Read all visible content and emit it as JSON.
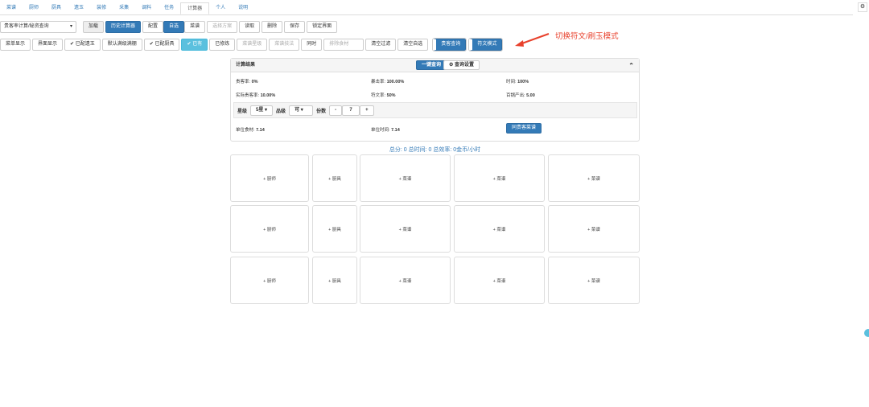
{
  "nav": [
    "菜谱",
    "厨师",
    "厨具",
    "遗玉",
    "装修",
    "采集",
    "调料",
    "任务",
    "计算器",
    "个人",
    "说明"
  ],
  "toolbar1": {
    "select": "贵客率计算/秘资查询",
    "load": "加载",
    "history": "历史计算器",
    "config": "配置",
    "self_select": "自选",
    "recipe": "菜谱",
    "choose_plan": "选择方案",
    "read": "读取",
    "delete": "删除",
    "save": "保存",
    "lock": "锁定界面"
  },
  "toolbar2": {
    "menu_show": "菜单显示",
    "ui_show": "界面显示",
    "jade": "已配遗玉",
    "default_full": "默认满级满棚",
    "chef_tool": "已配厨具",
    "have": "已有",
    "cultivated": "已修炼",
    "recipe_star": "菜谱星级",
    "recipe_skill": "菜谱技法",
    "same_time": "同时",
    "exclude": "排除食材",
    "clear_filter": "清空过滤",
    "clear_select": "清空自选",
    "guest_query": "贵客查询",
    "rune_mode": "符文模式"
  },
  "annotation": "切换符文/刷玉模式",
  "panel": {
    "title": "计算结果",
    "one_click": "一键查询",
    "query_settings": "查询设置",
    "guest_rate": "贵客率:",
    "guest_rate_v": "0%",
    "crit": "暴击率:",
    "crit_v": "100.00%",
    "time": "时间:",
    "time_v": "100%",
    "real_guest": "实际贵客率:",
    "real_guest_v": "10.00%",
    "rune_rate": "符文率:",
    "rune_rate_v": "50%",
    "output": "百锅产出:",
    "output_v": "5.00",
    "star": "星级",
    "star_v": "5星",
    "quality": "品级",
    "quality_v": "可",
    "portions": "份数",
    "minus": "-",
    "portions_v": "7",
    "plus": "+",
    "unit_mat": "单位食材:",
    "unit_mat_v": "7.14",
    "unit_time": "单位时间:",
    "unit_time_v": "7.14",
    "same_guest": "同贵客菜谱"
  },
  "summary": "总分: 0 总时间: 0 总效率: 0金币/小时",
  "grid": {
    "chef": "+ 厨师",
    "tool": "+ 厨具",
    "recipe": "+ 菜谱"
  }
}
